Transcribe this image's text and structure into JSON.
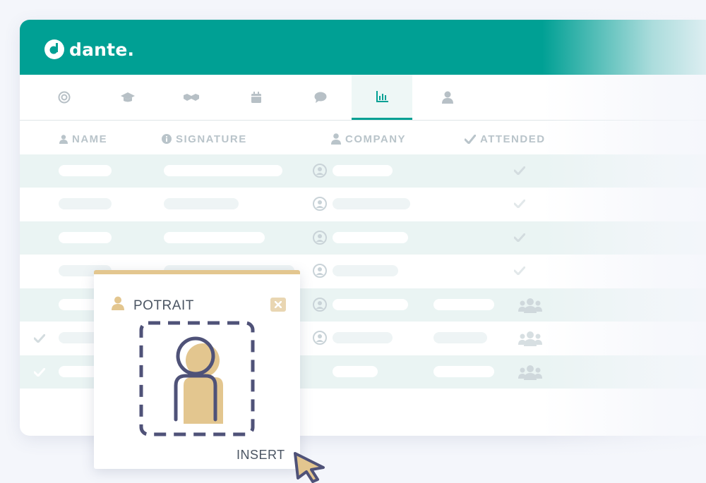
{
  "app": {
    "brand": "dante."
  },
  "tabs": [
    {
      "icon": "target-icon",
      "active": false
    },
    {
      "icon": "graduation-cap-icon",
      "active": false
    },
    {
      "icon": "handshake-icon",
      "active": false
    },
    {
      "icon": "calendar-icon",
      "active": false
    },
    {
      "icon": "chat-bubble-icon",
      "active": false
    },
    {
      "icon": "bar-chart-icon",
      "active": true
    },
    {
      "icon": "user-icon",
      "active": false
    }
  ],
  "table": {
    "columns": [
      {
        "label": "NAME",
        "icon": "user-icon"
      },
      {
        "label": "SIGNATURE",
        "icon": "info-icon"
      },
      {
        "label": "COMPANY",
        "icon": "user-icon"
      },
      {
        "label": "ATTENDED",
        "icon": "check-icon"
      }
    ]
  },
  "popup": {
    "title": "POTRAIT",
    "insert_label": "INSERT"
  },
  "colors": {
    "brand": "#00a094",
    "accent": "#e3c68f",
    "frame": "#4f5278"
  }
}
